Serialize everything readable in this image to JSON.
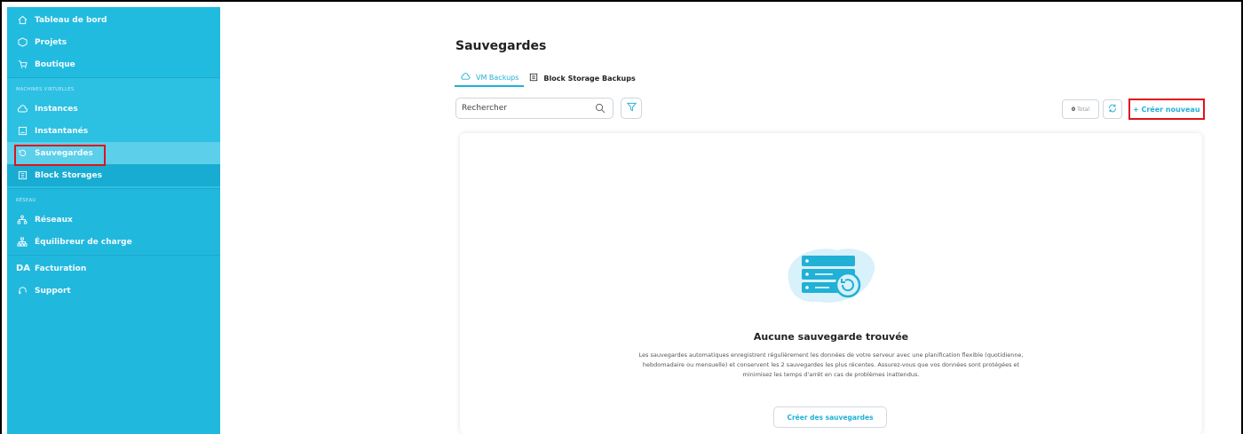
{
  "sidebar": {
    "top_items": [
      {
        "label": "Tableau de bord",
        "icon": "home-icon"
      },
      {
        "label": "Projets",
        "icon": "projects-icon"
      },
      {
        "label": "Boutique",
        "icon": "cart-icon"
      }
    ],
    "section_vm": "MACHINES VIRTUELLES",
    "vm_items": [
      {
        "label": "Instances",
        "icon": "cloud-icon"
      },
      {
        "label": "Instantanés",
        "icon": "snapshot-icon"
      },
      {
        "label": "Sauvegardes",
        "icon": "backup-icon"
      },
      {
        "label": "Block Storages",
        "icon": "storage-icon"
      }
    ],
    "section_network": "RÉSEAU",
    "network_items": [
      {
        "label": "Réseaux",
        "icon": "network-icon"
      },
      {
        "label": "Équilibreur de charge",
        "icon": "load-balancer-icon"
      }
    ],
    "bottom_items": [
      {
        "label": "Facturation",
        "badge": "DA"
      },
      {
        "label": "Support",
        "icon": "headset-icon"
      }
    ]
  },
  "main": {
    "title": "Sauvegardes",
    "tabs": [
      {
        "label": "VM Backups",
        "active": true
      },
      {
        "label": "Block Storage Backups",
        "active": false
      }
    ],
    "search_placeholder": "Rechercher",
    "total_count": "0",
    "total_label": "Total",
    "create_new": "+ Créer nouveau",
    "empty_title": "Aucune sauvegarde trouvée",
    "empty_desc": "Les sauvegardes automatiques enregistrent régulièrement les données de votre serveur avec une planification flexible (quotidienne, hebdomadaire ou mensuelle) et conservent les 2 sauvegardes les plus récentes. Assurez-vous que vos données sont protégées et minimisez les temps d'arrêt en cas de problèmes inattendus.",
    "create_backups": "Créer des sauvegardes"
  },
  "colors": {
    "sidebar_bg": "#21b8dd",
    "accent": "#21b0d6",
    "highlight_box": "#e0121b"
  }
}
